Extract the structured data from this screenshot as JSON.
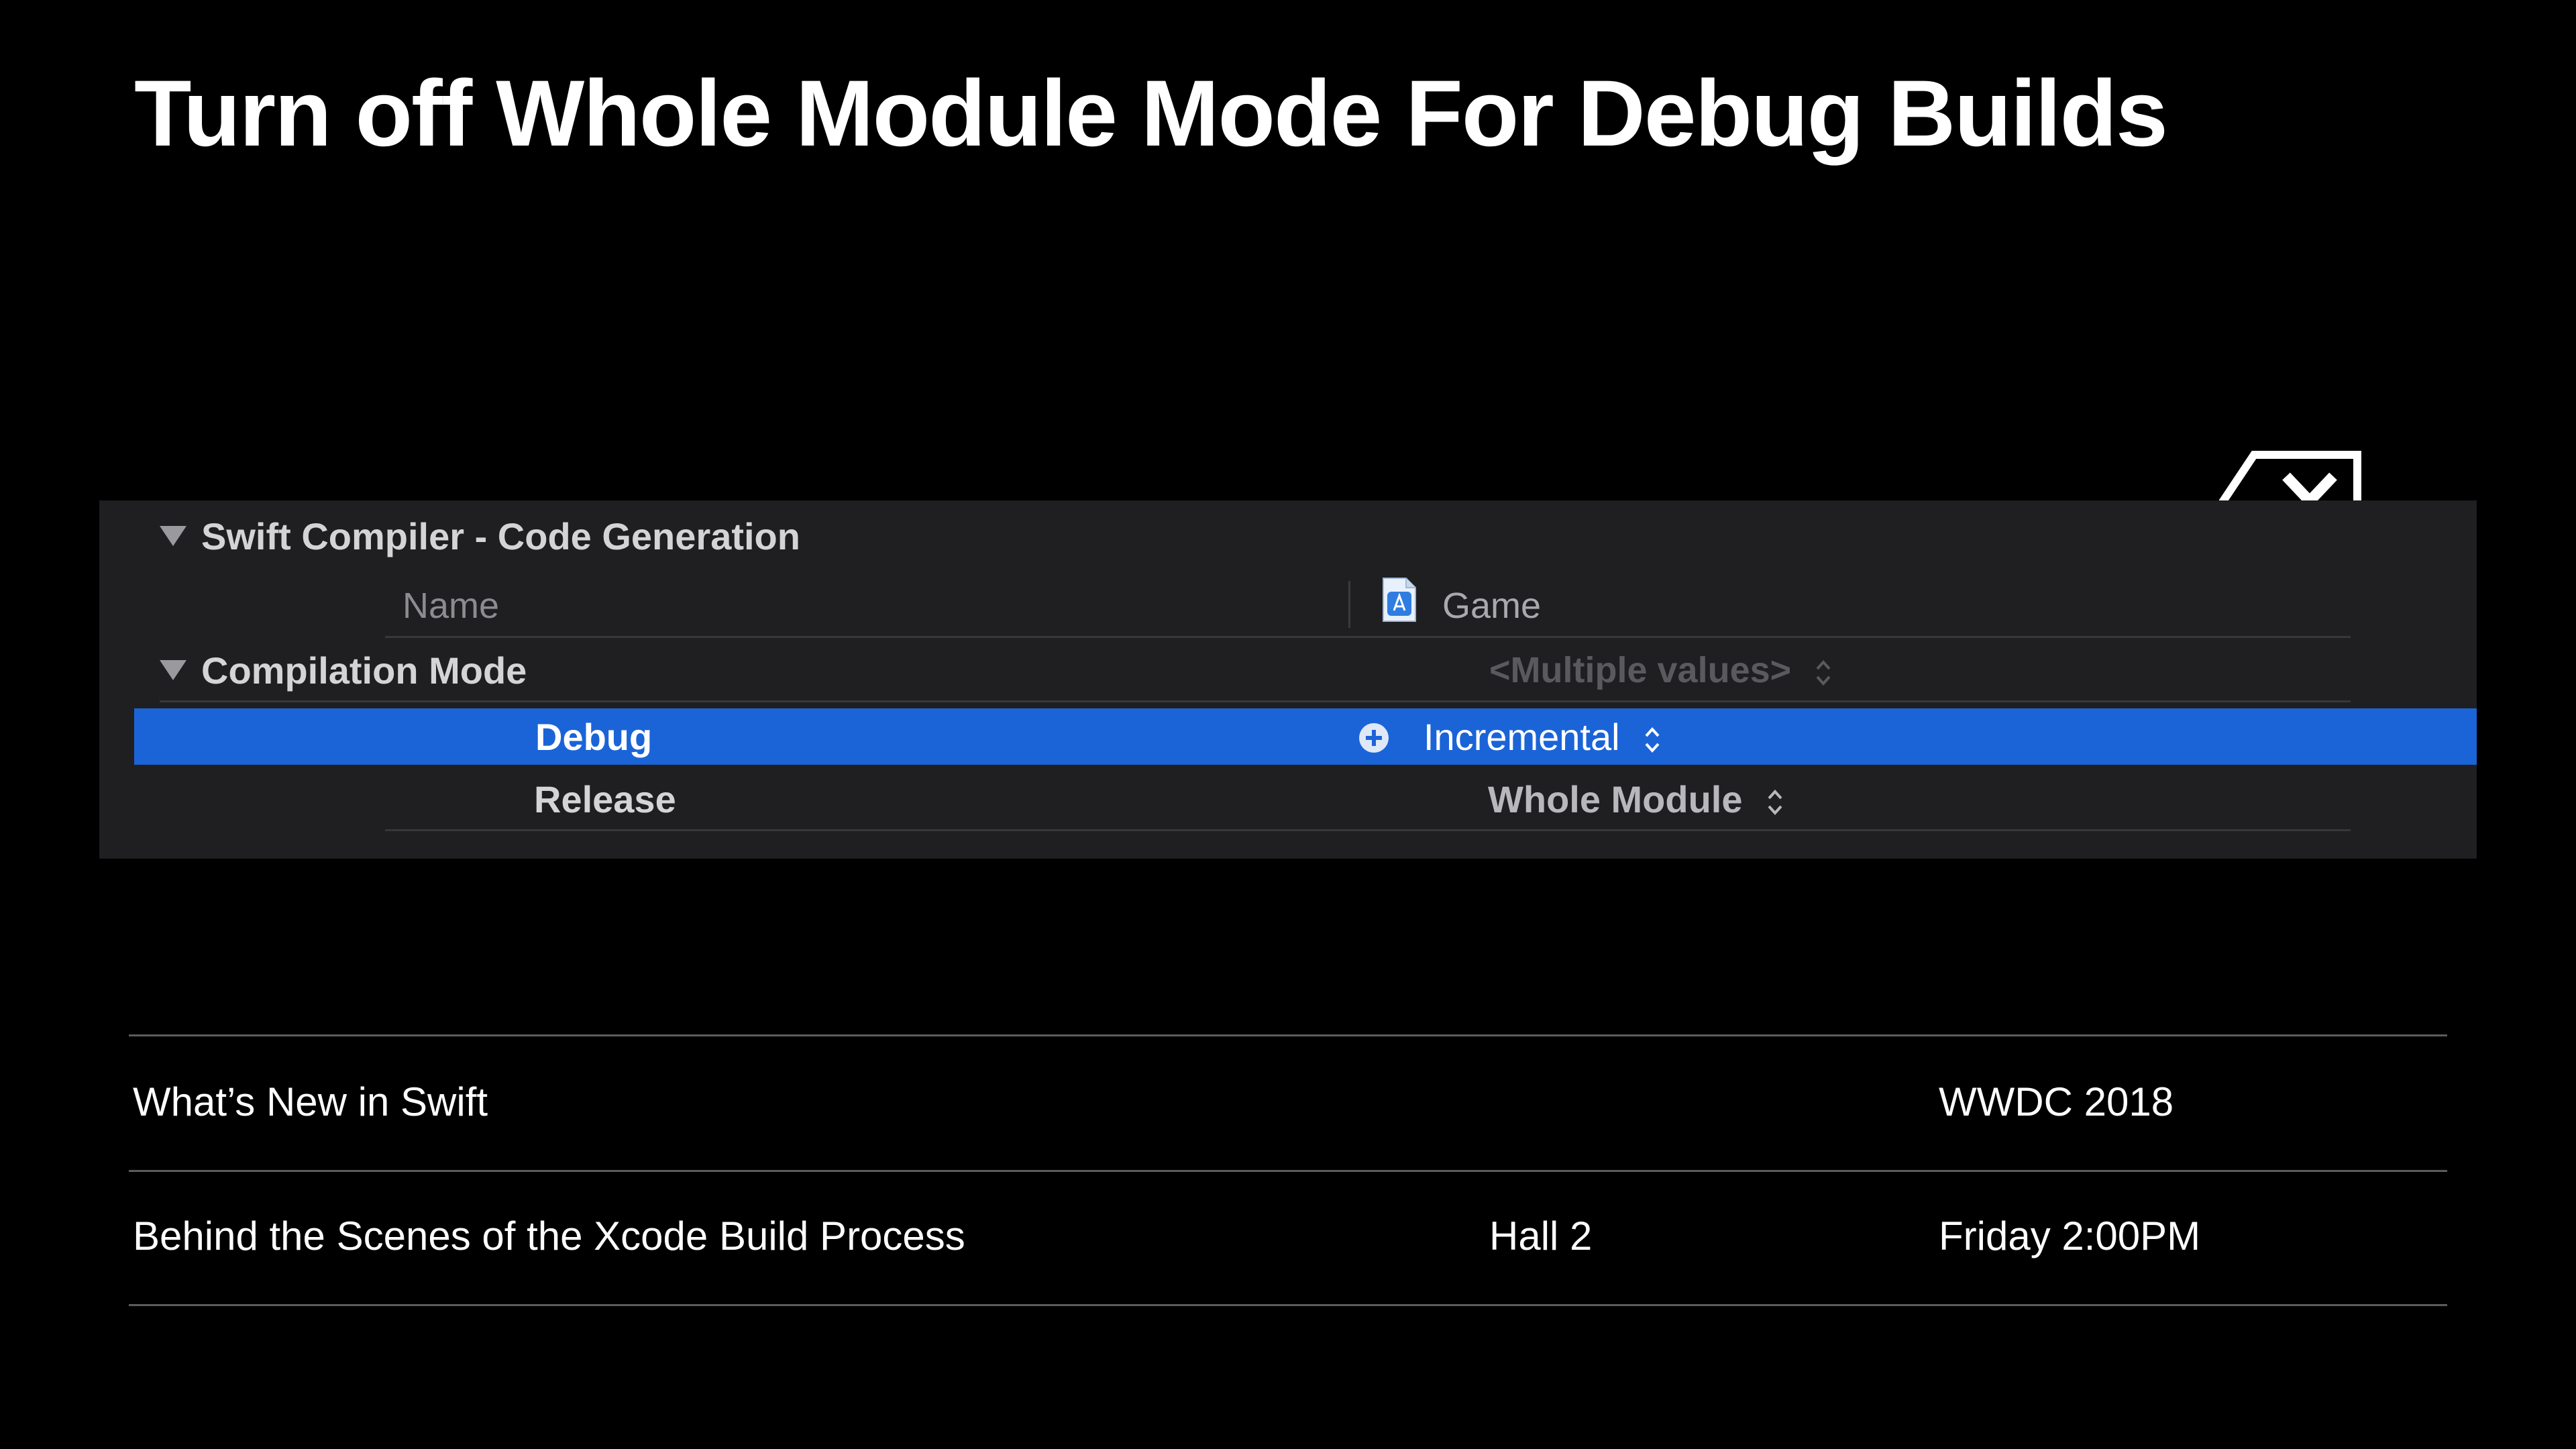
{
  "slide": {
    "title": "Turn off Whole Module Mode For Debug Builds"
  },
  "build_settings": {
    "section_title": "Swift Compiler - Code Generation",
    "columns": {
      "name": "Name",
      "target": "Game"
    },
    "setting": {
      "label": "Compilation Mode",
      "value": "<Multiple values>"
    },
    "rows": [
      {
        "label": "Debug",
        "value": "Incremental",
        "selected": true
      },
      {
        "label": "Release",
        "value": "Whole Module",
        "selected": false
      }
    ],
    "colors": {
      "selection": "#1b64d8",
      "panel_background": "#1f1f21"
    }
  },
  "icons": {
    "delete": "delete-backward-icon",
    "target": "app-target-icon",
    "add": "plus-circle-icon",
    "stepper": "up-down-chevron-icon",
    "disclosure": "disclosure-triangle-icon"
  },
  "related_sessions": [
    {
      "title": "What’s New in Swift",
      "location": "",
      "time": "WWDC 2018"
    },
    {
      "title": "Behind the Scenes of the Xcode Build Process",
      "location": "Hall 2",
      "time": "Friday 2:00PM"
    }
  ]
}
